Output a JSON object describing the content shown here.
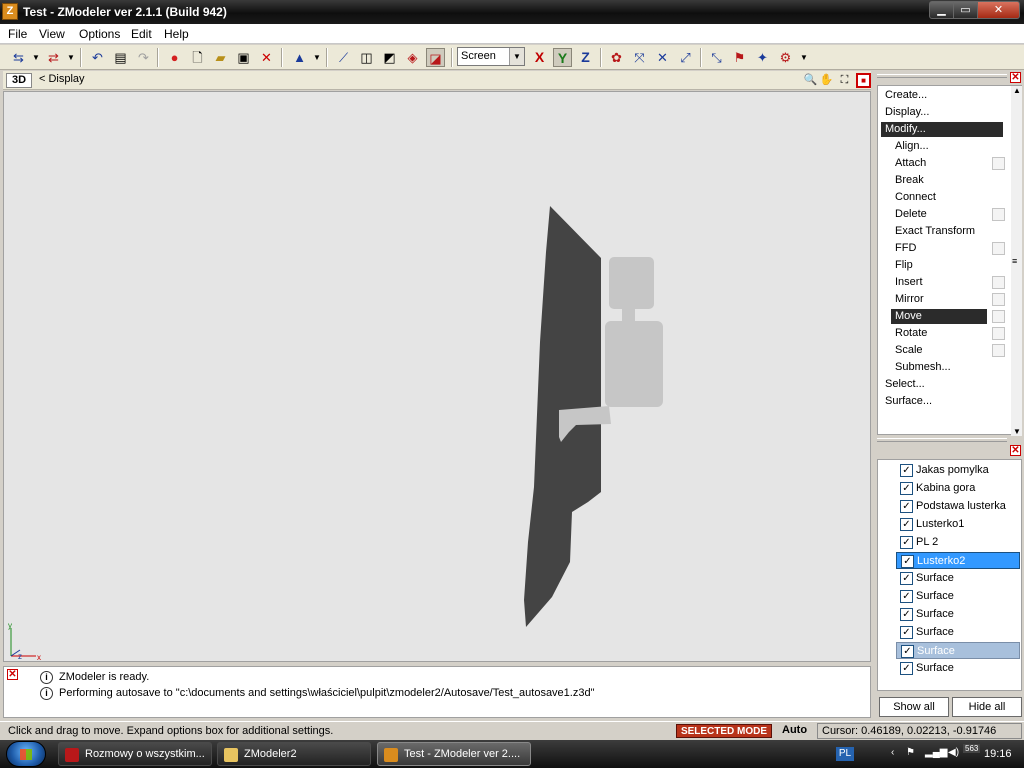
{
  "window": {
    "title": "Test - ZModeler ver 2.1.1 (Build 942)",
    "app_icon": "Z",
    "controls": {
      "minimize": "▁",
      "maximize": "▭",
      "close": "✕"
    }
  },
  "menubar": [
    "File",
    "View",
    "Options",
    "Edit",
    "Help"
  ],
  "toolbar": {
    "view_select": "Screen",
    "axes": [
      "X",
      "Y",
      "Z"
    ],
    "axis_colors": {
      "x": "#c00000",
      "y": "#1a7a1a",
      "z": "#1a3a9a"
    }
  },
  "viewport": {
    "mode": "3D",
    "breadcrumb": "< Display",
    "background": "#e5e5e5",
    "axis_labels": {
      "y": "y",
      "z": "z",
      "x": "x"
    }
  },
  "command_panel": {
    "items": [
      {
        "label": "Create...",
        "level": 0
      },
      {
        "label": "Display...",
        "level": 0
      },
      {
        "label": "Modify...",
        "level": 0,
        "selected": true
      },
      {
        "label": "Align...",
        "level": 1
      },
      {
        "label": "Attach",
        "level": 1,
        "checkbox": true
      },
      {
        "label": "Break",
        "level": 1
      },
      {
        "label": "Connect",
        "level": 1
      },
      {
        "label": "Delete",
        "level": 1,
        "checkbox": true
      },
      {
        "label": "Exact Transform",
        "level": 1
      },
      {
        "label": "FFD",
        "level": 1,
        "checkbox": true
      },
      {
        "label": "Flip",
        "level": 1
      },
      {
        "label": "Insert",
        "level": 1,
        "checkbox": true
      },
      {
        "label": "Mirror",
        "level": 1,
        "checkbox": true
      },
      {
        "label": "Move",
        "level": 1,
        "checkbox": true,
        "selected": true
      },
      {
        "label": "Rotate",
        "level": 1,
        "checkbox": true
      },
      {
        "label": "Scale",
        "level": 1,
        "checkbox": true
      },
      {
        "label": "Submesh...",
        "level": 1
      },
      {
        "label": "Select...",
        "level": 0
      },
      {
        "label": "Surface...",
        "level": 0
      }
    ]
  },
  "objects_panel": {
    "items": [
      {
        "label": "Jakas pomylka",
        "checked": true
      },
      {
        "label": "Kabina gora",
        "checked": true
      },
      {
        "label": "Podstawa lusterka",
        "checked": true
      },
      {
        "label": "Lusterko1",
        "checked": true
      },
      {
        "label": "PL 2",
        "checked": true
      },
      {
        "label": "Lusterko2",
        "checked": true,
        "state": "selected"
      },
      {
        "label": "Surface",
        "checked": true
      },
      {
        "label": "Surface",
        "checked": true
      },
      {
        "label": "Surface",
        "checked": true
      },
      {
        "label": "Surface",
        "checked": true
      },
      {
        "label": "Surface",
        "checked": true,
        "state": "highlighted"
      },
      {
        "label": "Surface",
        "checked": true
      }
    ],
    "show_all": "Show all",
    "hide_all": "Hide all"
  },
  "log": {
    "lines": [
      "ZModeler is ready.",
      "Performing autosave to \"c:\\documents and settings\\właściciel\\pulpit\\zmodeler2/Autosave/Test_autosave1.z3d\""
    ]
  },
  "statusbar": {
    "hint": "Click and drag to move. Expand options box for additional settings.",
    "mode": "SELECTED MODE",
    "auto": "Auto",
    "cursor": "Cursor: 0.46189, 0.02213, -0.91746"
  },
  "taskbar": {
    "tasks": [
      {
        "label": "Rozmowy o wszystkim...",
        "icon_color": "#b8181a"
      },
      {
        "label": "ZModeler2",
        "icon_color": "#e8c460"
      },
      {
        "label": "Test - ZModeler ver 2....",
        "icon_color": "#d98c1e",
        "active": true
      }
    ],
    "lang": "PL",
    "tray_badge": "563",
    "clock": "19:16"
  }
}
